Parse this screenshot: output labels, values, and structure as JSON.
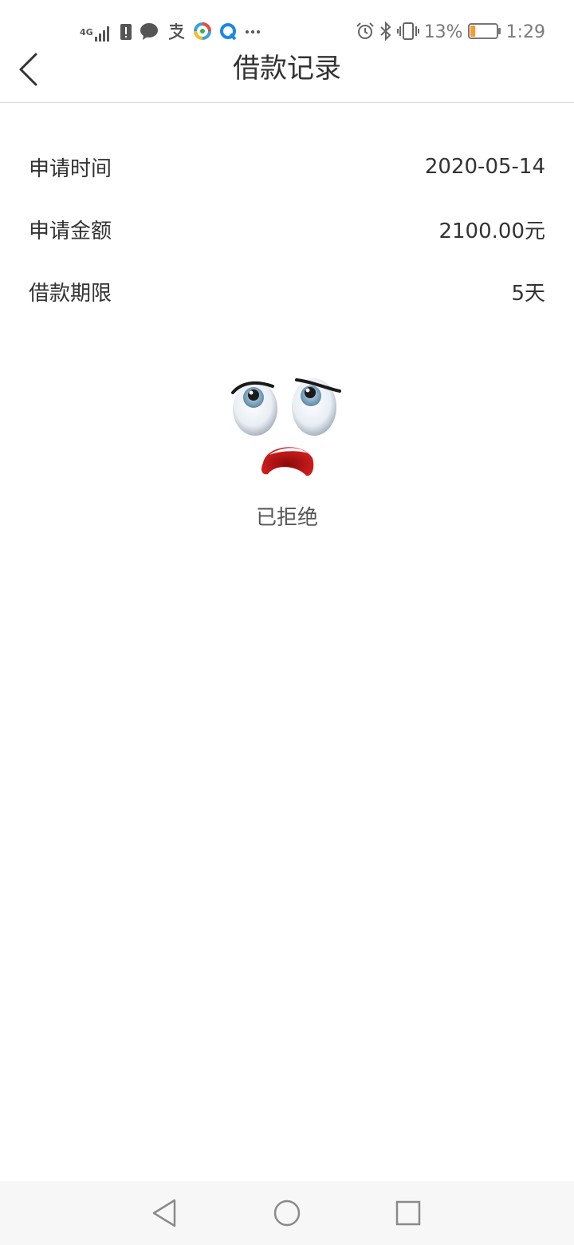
{
  "status_bar": {
    "network": "4G",
    "battery_percent": "13%",
    "battery_level": 0.13,
    "time": "1:29",
    "icons_left": [
      "signal-icon",
      "sim-alert-icon",
      "message-icon",
      "alipay-icon",
      "app-icon",
      "browser-icon",
      "more-icon"
    ],
    "icons_right": [
      "alarm-icon",
      "bluetooth-icon",
      "vibrate-icon",
      "battery-icon"
    ]
  },
  "header": {
    "title": "借款记录"
  },
  "record": {
    "rows": [
      {
        "label": "申请时间",
        "value": "2020-05-14"
      },
      {
        "label": "申请金额",
        "value": "2100.00元"
      },
      {
        "label": "借款期限",
        "value": "5天"
      }
    ]
  },
  "result": {
    "status_text": "已拒绝"
  },
  "colors": {
    "battery_fill": "#f0a030",
    "mouth": "#b81818"
  }
}
